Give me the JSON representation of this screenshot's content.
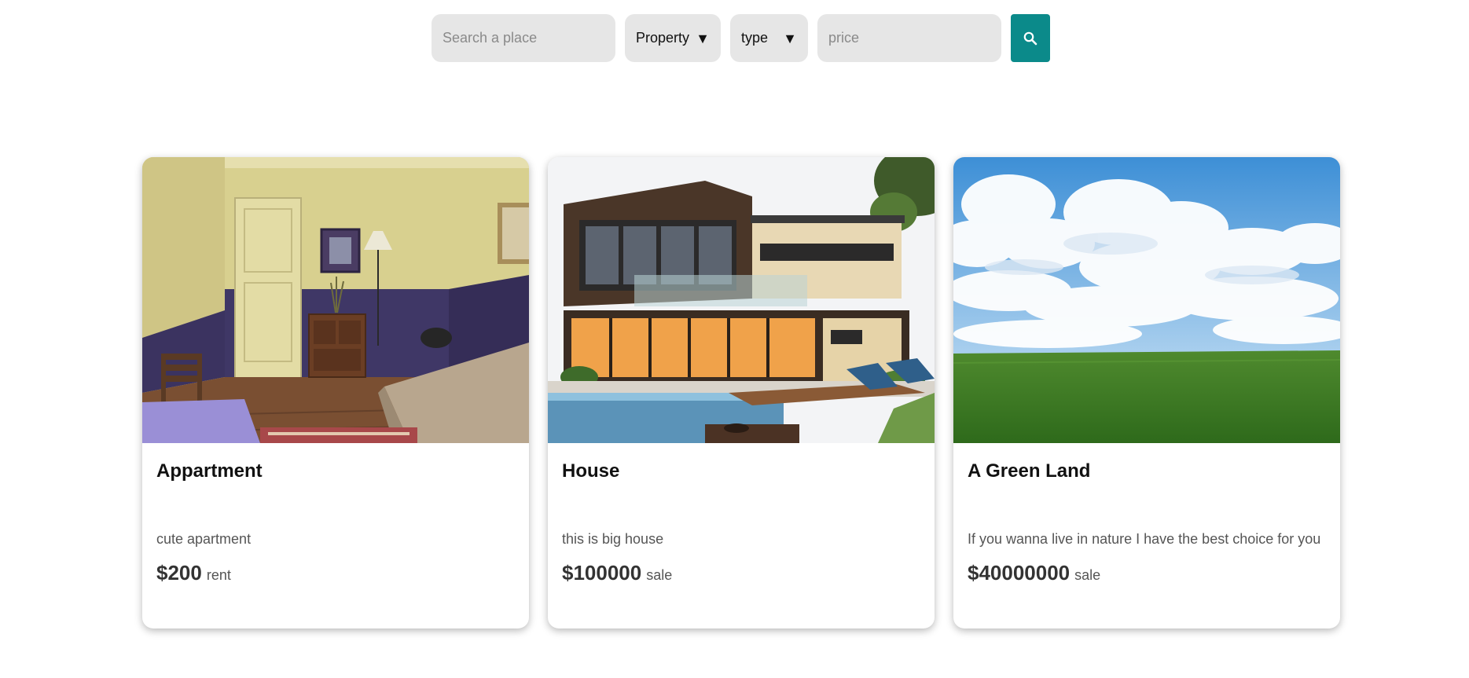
{
  "search": {
    "place_placeholder": "Search a place",
    "property_label": "Property",
    "type_label": "type",
    "price_placeholder": "price",
    "caret": "▼",
    "button_icon": "search-icon",
    "accent_color": "#0b8a8a"
  },
  "listings": [
    {
      "title": "Appartment",
      "description": "cute apartment",
      "price": "$200",
      "kind": "rent",
      "image": "apartment-room-photo"
    },
    {
      "title": "House",
      "description": "this is big house",
      "price": "$100000",
      "kind": "sale",
      "image": "modern-house-pool-photo"
    },
    {
      "title": "A Green Land",
      "description": "If you wanna live in nature I have the best choice for you",
      "price": "$40000000",
      "kind": "sale",
      "image": "green-field-sky-photo"
    }
  ]
}
